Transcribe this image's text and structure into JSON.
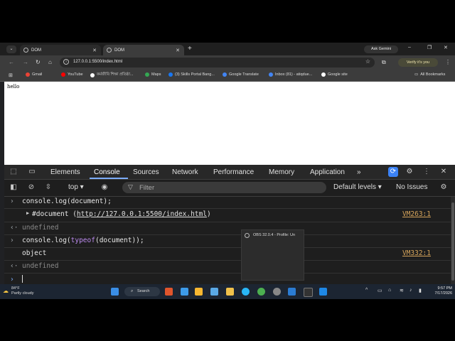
{
  "browser": {
    "tabs": [
      {
        "title": "DOM"
      },
      {
        "title": "DOM"
      }
    ],
    "new_tab": "+",
    "ask_gemini": "Ask Gemini",
    "window_controls": {
      "minimize": "–",
      "maximize": "❐",
      "close": "✕"
    },
    "url": "127.0.0.1:5500/index.html",
    "verify_label": "Verify it's you",
    "bookmarks": [
      {
        "label": "Gmail",
        "color": "#ea4335"
      },
      {
        "label": "YouTube",
        "color": "#ff0000"
      },
      {
        "label": "কর্মজীবি শিক্ষা প্রতিষ্ঠা...",
        "color": "#ffffff"
      },
      {
        "label": "Maps",
        "color": "#34a853"
      },
      {
        "label": "(3) Skills Portal Bang...",
        "color": "#1877f2"
      },
      {
        "label": "Google Translate",
        "color": "#4285f4"
      },
      {
        "label": "Inbox (81) - atiqdue...",
        "color": "#4285f4"
      },
      {
        "label": "Google site",
        "color": "#ffffff"
      }
    ],
    "all_bookmarks": "All Bookmarks"
  },
  "page": {
    "body_text": "hello"
  },
  "devtools": {
    "tabs": [
      "Elements",
      "Console",
      "Sources",
      "Network",
      "Performance",
      "Memory",
      "Application"
    ],
    "active_tab": "Console",
    "more_tabs": "»",
    "context": "top",
    "filter_placeholder": "Filter",
    "levels": "Default levels",
    "issues": "No Issues",
    "console": [
      {
        "prefix": "›",
        "text": "console.log(document);",
        "source": ""
      },
      {
        "prefix": "",
        "text": "#document (http://127.0.0.1:5500/index.html)",
        "source": "VM263:1"
      },
      {
        "prefix": "‹·",
        "text": "undefined",
        "source": ""
      },
      {
        "prefix": "›",
        "text": "console.log(typeof(document));",
        "source": ""
      },
      {
        "prefix": "",
        "text": "object",
        "source": "VM332:1"
      },
      {
        "prefix": "‹·",
        "text": "undefined",
        "source": ""
      },
      {
        "prefix": "›",
        "text": "",
        "source": ""
      }
    ]
  },
  "obs_popup": {
    "title": "OBS 32.0.4 - Profile: Un"
  },
  "taskbar": {
    "weather_temp": "84°F",
    "weather_desc": "Partly cloudy",
    "search": "Search",
    "time": "9:57 PM",
    "date": "7/17/2026"
  },
  "colors": {
    "accent": "#7cacf8",
    "source_link": "#d4a35a",
    "keyword": "#bd8cf0"
  }
}
